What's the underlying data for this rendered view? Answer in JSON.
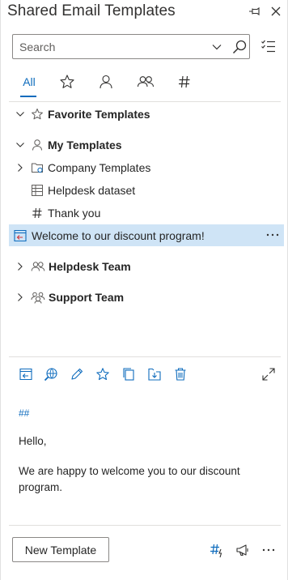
{
  "header": {
    "title": "Shared Email Templates"
  },
  "search": {
    "placeholder": "Search",
    "value": ""
  },
  "tabs": [
    {
      "label": "All",
      "active": true
    },
    {
      "icon": "star-icon"
    },
    {
      "icon": "person-icon"
    },
    {
      "icon": "people-icon"
    },
    {
      "icon": "hashtag-icon"
    }
  ],
  "tree": {
    "favorites": {
      "label": "Favorite Templates"
    },
    "my_templates": {
      "label": "My Templates"
    },
    "company_templates": {
      "label": "Company Templates"
    },
    "helpdesk_dataset": {
      "label": "Helpdesk dataset"
    },
    "thank_you": {
      "label": "Thank you"
    },
    "welcome": {
      "label": "Welcome to our discount program!",
      "selected": true
    },
    "helpdesk_team": {
      "label": "Helpdesk Team"
    },
    "support_team": {
      "label": "Support Team"
    }
  },
  "preview": {
    "hash": "##",
    "greeting": "Hello,",
    "body": "We are happy to welcome you to our discount program."
  },
  "footer": {
    "new_template_label": "New Template"
  },
  "colors": {
    "accent": "#0f6cbd",
    "selected_row": "#cfe4f6"
  }
}
